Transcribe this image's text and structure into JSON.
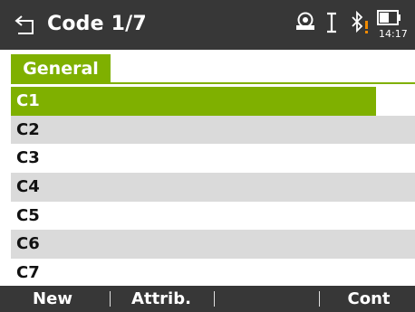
{
  "header": {
    "title": "Code 1/7",
    "time": "14:17",
    "icons": [
      "back-arrow-icon",
      "target-prism-icon",
      "ibeam-cursor-icon",
      "bluetooth-warning-icon",
      "battery-icon"
    ]
  },
  "tabs": [
    {
      "label": "General",
      "active": true
    }
  ],
  "codes": [
    {
      "label": "C1",
      "selected": true
    },
    {
      "label": "C2",
      "selected": false
    },
    {
      "label": "C3",
      "selected": false
    },
    {
      "label": "C4",
      "selected": false
    },
    {
      "label": "C5",
      "selected": false
    },
    {
      "label": "C6",
      "selected": false
    },
    {
      "label": "C7",
      "selected": false
    }
  ],
  "softkeys": [
    "New",
    "Attrib.",
    "",
    "Cont"
  ],
  "colors": {
    "titlebar": "#373737",
    "accent_green": "#7fb000",
    "alt_row": "#dadada",
    "warning_orange": "#f08a00"
  }
}
